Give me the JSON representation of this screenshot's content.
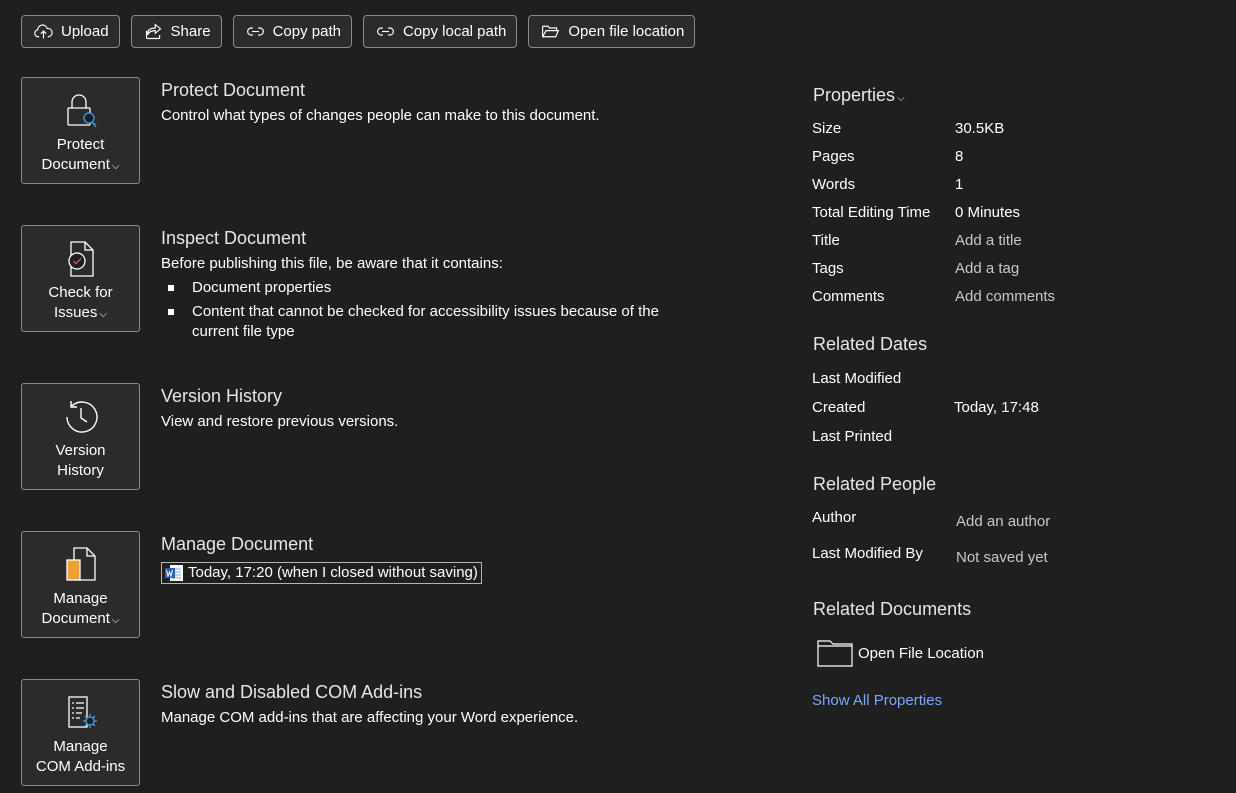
{
  "toolbar": {
    "upload": "Upload",
    "share": "Share",
    "copy_path": "Copy path",
    "copy_local_path": "Copy local path",
    "open_file_location": "Open file location"
  },
  "sections": {
    "protect": {
      "button_line1": "Protect",
      "button_line2": "Document",
      "title": "Protect Document",
      "desc": "Control what types of changes people can make to this document."
    },
    "inspect": {
      "button_line1": "Check for",
      "button_line2": "Issues",
      "title": "Inspect Document",
      "desc": "Before publishing this file, be aware that it contains:",
      "items": [
        "Document properties",
        "Content that cannot be checked for accessibility issues because of the current file type"
      ]
    },
    "version": {
      "button_line1": "Version",
      "button_line2": "History",
      "title": "Version History",
      "desc": "View and restore previous versions."
    },
    "manage": {
      "button_line1": "Manage",
      "button_line2": "Document",
      "title": "Manage Document",
      "version_item": "Today, 17:20 (when I closed without saving)"
    },
    "com": {
      "button_line1": "Manage",
      "button_line2": "COM Add-ins",
      "title": "Slow and Disabled COM Add-ins",
      "desc": "Manage COM add-ins that are affecting your Word experience."
    }
  },
  "properties": {
    "title": "Properties",
    "rows": [
      {
        "key": "Size",
        "value": "30.5KB"
      },
      {
        "key": "Pages",
        "value": "8"
      },
      {
        "key": "Words",
        "value": "1"
      },
      {
        "key": "Total Editing Time",
        "value": "0 Minutes"
      },
      {
        "key": "Title",
        "value": "Add a title"
      },
      {
        "key": "Tags",
        "value": "Add a tag"
      },
      {
        "key": "Comments",
        "value": "Add comments"
      }
    ]
  },
  "related_dates": {
    "title": "Related Dates",
    "rows": [
      {
        "key": "Last Modified",
        "value": ""
      },
      {
        "key": "Created",
        "value": "Today, 17:48"
      },
      {
        "key": "Last Printed",
        "value": ""
      }
    ]
  },
  "related_people": {
    "title": "Related People",
    "rows": [
      {
        "key": "Author",
        "value": "Add an author"
      },
      {
        "key": "Last Modified By",
        "value": "Not saved yet"
      }
    ]
  },
  "related_documents": {
    "title": "Related Documents",
    "open_file_location": "Open File Location"
  },
  "show_all_properties": "Show All Properties",
  "colors": {
    "background": "#1f1f1f",
    "button_bg": "#2b2b2b",
    "border": "#8a8a8a",
    "link": "#7aa7ff",
    "accent_blue": "#3aa0e8",
    "alert_red": "#e05252",
    "doc_orange": "#f0a030"
  }
}
